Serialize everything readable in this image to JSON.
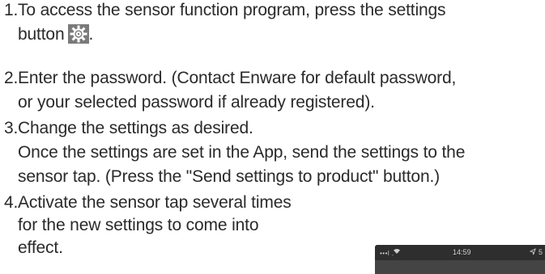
{
  "steps": [
    {
      "number": "1.",
      "lines": [
        "To access the sensor function program, press the settings",
        "button"
      ],
      "trailing": ".",
      "icon": "gear-icon"
    },
    {
      "number": "2.",
      "lines": [
        "Enter the password. (Contact Enware for default password,",
        "or your selected password if already registered)."
      ]
    },
    {
      "number": "3.",
      "lines": [
        "Change the settings as desired.",
        "Once the settings are set in the App, send the settings to the",
        "sensor tap. (Press the \"Send settings to product\" button.)"
      ]
    },
    {
      "number": "4.",
      "lines": [
        "Activate the sensor tap several times",
        "for the new settings to come into",
        "effect."
      ]
    }
  ],
  "phone": {
    "signal": "•••l .",
    "time": "14:59",
    "location_icon": "location-arrow-icon",
    "battery_text": "5",
    "wifi_icon": "wifi-icon"
  },
  "colors": {
    "text": "#2a2a2a",
    "gear_background": "#7a7a7a",
    "phone_dark": "#3b3b3b"
  }
}
